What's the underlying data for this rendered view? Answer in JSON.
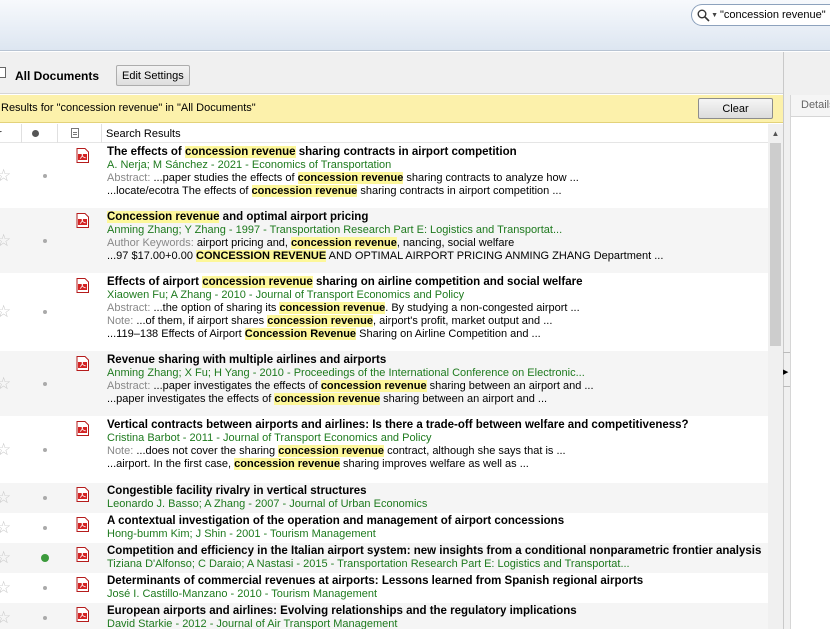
{
  "search": {
    "value": "\"concession revenue\"",
    "icon": "search-icon"
  },
  "collection": {
    "title": "All Documents",
    "edit_label": "Edit Settings"
  },
  "banner": {
    "text": "Results for \"concession revenue\" in \"All Documents\"",
    "clear_label": "Clear"
  },
  "columns": {
    "r_label": "r",
    "title_header": "Search Results"
  },
  "details": {
    "tab_label": "Details"
  },
  "colors": {
    "highlight": "#fdf79a",
    "meta_green": "#1e7a1e",
    "banner": "#fcf1ab",
    "pdf_red": "#d32323"
  },
  "results": [
    {
      "title": [
        "The effects of ",
        "@concession revenue",
        " sharing contracts in airport competition"
      ],
      "meta": "A. Nerja; M Sánchez - 2021 - Economics of Transportation",
      "snippets": [
        {
          "label": "Abstract: ",
          "parts": [
            "...paper studies the effects of ",
            "@concession revenue",
            " sharing contracts to analyze how ..."
          ]
        },
        {
          "label": "",
          "parts": [
            "...locate/ecotra The effects of ",
            "@concession revenue",
            " sharing contracts in airport competition ..."
          ]
        }
      ],
      "unread": false
    },
    {
      "title": [
        "@Concession revenue",
        " and optimal airport pricing"
      ],
      "meta": "Anming Zhang; Y Zhang - 1997 - Transportation Research Part E: Logistics and Transportat...",
      "snippets": [
        {
          "label": "Author Keywords: ",
          "parts": [
            "airport pricing and, ",
            "@concession revenue",
            ", nancing, social welfare"
          ]
        },
        {
          "label": "",
          "parts": [
            "...97 $17.00+0.00 ",
            "@CONCESSION REVENUE",
            " AND OPTIMAL AIRPORT PRICING ANMING ZHANG Department ..."
          ]
        }
      ],
      "unread": false
    },
    {
      "title": [
        "Effects of airport ",
        "@concession revenue",
        " sharing on airline competition and social welfare"
      ],
      "meta": "Xiaowen Fu; A Zhang - 2010 - Journal of Transport Economics and Policy",
      "snippets": [
        {
          "label": "Abstract: ",
          "parts": [
            "...the option of sharing its ",
            "@concession revenue",
            ". By studying a non-congested airport ..."
          ]
        },
        {
          "label": "Note: ",
          "parts": [
            "...of them, if airport shares ",
            "@concession revenue",
            ", airport's profit, market output and ..."
          ]
        },
        {
          "label": "",
          "parts": [
            "...119–138 Effects of Airport ",
            "@Concession Revenue",
            " Sharing on Airline Competition and ..."
          ]
        }
      ],
      "unread": false
    },
    {
      "title": [
        "Revenue sharing with multiple airlines and airports"
      ],
      "meta": "Anming Zhang; X Fu; H Yang - 2010 - Proceedings of the International Conference on Electronic...",
      "snippets": [
        {
          "label": "Abstract: ",
          "parts": [
            "...paper investigates the effects of ",
            "@concession revenue",
            " sharing between an airport and ..."
          ]
        },
        {
          "label": "",
          "parts": [
            "...paper investigates the effects of ",
            "@concession revenue",
            " sharing between an airport and ..."
          ]
        }
      ],
      "unread": false
    },
    {
      "title": [
        "Vertical contracts between airports and airlines: Is there a trade-off between welfare and competitiveness?"
      ],
      "meta": "Cristina Barbot - 2011 - Journal of Transport Economics and Policy",
      "snippets": [
        {
          "label": "Note: ",
          "parts": [
            "...does not cover the sharing ",
            "@concession revenue",
            " contract, although she says that is ..."
          ]
        },
        {
          "label": "",
          "parts": [
            "...airport. In the first case, ",
            "@concession revenue",
            " sharing improves welfare as well as ..."
          ]
        }
      ],
      "unread": false
    },
    {
      "title": [
        "Congestible facility rivalry in vertical structures"
      ],
      "meta": "Leonardo J. Basso; A Zhang - 2007 - Journal of Urban Economics",
      "snippets": [],
      "unread": false
    },
    {
      "title": [
        "A contextual investigation of the operation and management of airport concessions"
      ],
      "meta": "Hong-bumm Kim; J Shin - 2001 - Tourism Management",
      "snippets": [],
      "unread": false
    },
    {
      "title": [
        "Competition and efficiency in the Italian airport system: new insights from a conditional nonparametric frontier analysis"
      ],
      "meta": "Tiziana D'Alfonso; C Daraio; A Nastasi - 2015 - Transportation Research Part E: Logistics and Transportat...",
      "snippets": [],
      "unread": true
    },
    {
      "title": [
        "Determinants of commercial revenues at airports: Lessons learned from Spanish regional airports"
      ],
      "meta": "José I. Castillo-Manzano - 2010 - Tourism Management",
      "snippets": [],
      "unread": false
    },
    {
      "title": [
        "European airports and airlines: Evolving relationships and the regulatory implications"
      ],
      "meta": "David Starkie - 2012 - Journal of Air Transport Management",
      "snippets": [],
      "unread": false
    }
  ]
}
